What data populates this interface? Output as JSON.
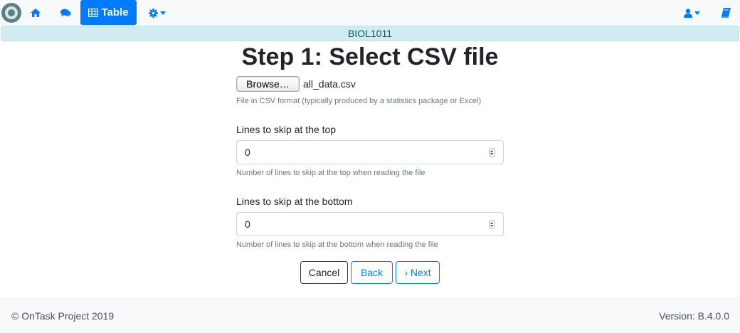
{
  "navbar": {
    "logo": "ontask-logo",
    "home_icon": "home-icon",
    "messages_icon": "comments-icon",
    "table_button": {
      "icon": "table-icon",
      "label": "Table"
    },
    "settings_icon": "gear-icon",
    "user_icon": "user-icon",
    "docs_icon": "book-icon",
    "accent_color": "#007bff"
  },
  "course": {
    "name": "BIOL1011",
    "bg_color": "#d1ecf1"
  },
  "page": {
    "title": "Step 1: Select CSV file",
    "file": {
      "browse_label": "Browse…",
      "file_name": "all_data.csv",
      "help": "File in CSV format (typically produced by a statistics package or Excel)"
    },
    "skip_top": {
      "label": "Lines to skip at the top",
      "value": "0",
      "help": "Number of lines to skip at the top when reading the file"
    },
    "skip_bottom": {
      "label": "Lines to skip at the bottom",
      "value": "0",
      "help": "Number of lines to skip at the bottom when reading the file"
    },
    "buttons": {
      "cancel": "Cancel",
      "back": "Back",
      "next": "Next",
      "next_icon": "chevron-right-icon"
    }
  },
  "footer": {
    "copyright": "© OnTask Project 2019",
    "version": "Version: B.4.0.0"
  }
}
